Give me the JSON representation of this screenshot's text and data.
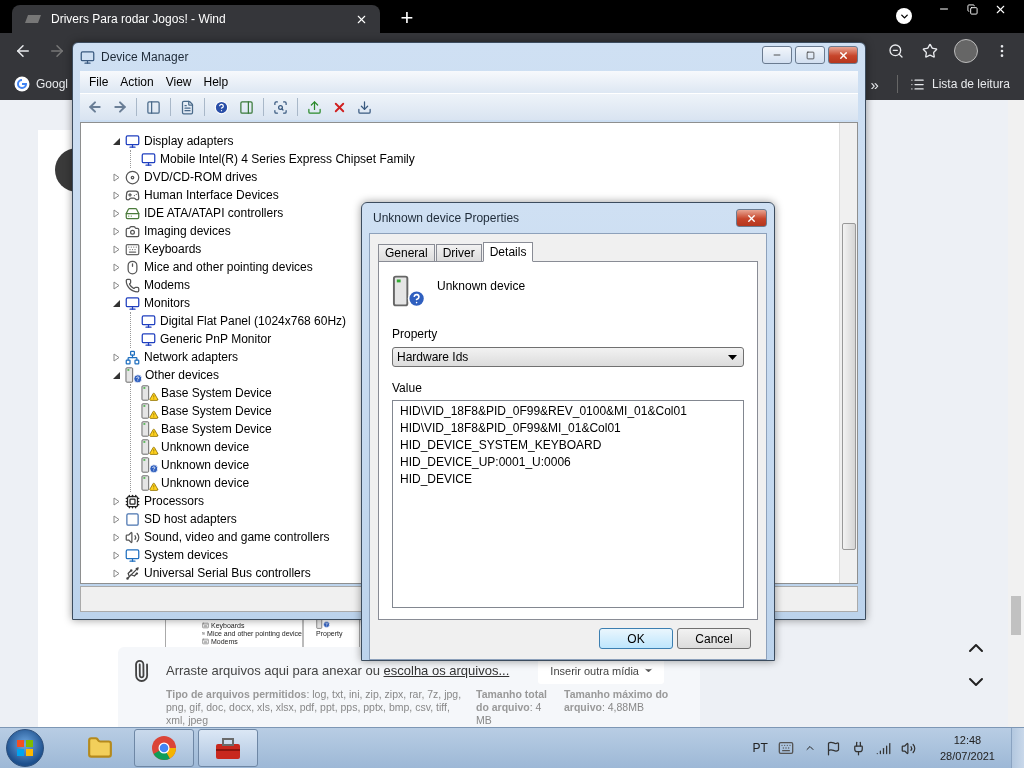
{
  "browser": {
    "tab_title": "Drivers Para rodar Jogos! - Wind",
    "new_tab": "+",
    "bookmarks": [
      {
        "label": "Googl"
      }
    ],
    "bookmarks_overflow": "»",
    "reading_list": "Lista de leitura"
  },
  "page": {
    "thumbnail": {
      "tree_items": [
        "Keyboards",
        "Mice and other pointing device",
        "Modems"
      ],
      "property_label": "Property"
    },
    "attachments": {
      "prompt": "Arraste arquivos aqui para anexar ou",
      "link": "escolha os arquivos...",
      "media_button": "Inserir outra mídia",
      "allowed_types": "**Tipo de arquivos permitidos**: log, txt, ini, zip, zipx, rar, 7z, jpg, png, gif, doc, docx, xls, xlsx, pdf, ppt, pps, pptx, bmp, csv, tiff, xml, jpeg",
      "total_size": "**Tamanho total do arquivo**: 4 MB",
      "max_size": "**Tamanho máximo do arquivo**: 4,88MB"
    }
  },
  "device_manager": {
    "title": "Device Manager",
    "menu": [
      "File",
      "Action",
      "View",
      "Help"
    ],
    "tree": [
      {
        "label": "Display adapters",
        "expanded": true,
        "children": [
          {
            "label": "Mobile Intel(R) 4 Series Express Chipset Family"
          }
        ]
      },
      {
        "label": "DVD/CD-ROM drives",
        "expanded": false
      },
      {
        "label": "Human Interface Devices",
        "expanded": false
      },
      {
        "label": "IDE ATA/ATAPI controllers",
        "expanded": false
      },
      {
        "label": "Imaging devices",
        "expanded": false
      },
      {
        "label": "Keyboards",
        "expanded": false
      },
      {
        "label": "Mice and other pointing devices",
        "expanded": false
      },
      {
        "label": "Modems",
        "expanded": false
      },
      {
        "label": "Monitors",
        "expanded": true,
        "children": [
          {
            "label": "Digital Flat Panel (1024x768 60Hz)"
          },
          {
            "label": "Generic PnP Monitor"
          }
        ]
      },
      {
        "label": "Network adapters",
        "expanded": false
      },
      {
        "label": "Other devices",
        "expanded": true,
        "children": [
          {
            "label": "Base System Device",
            "kind": "warning"
          },
          {
            "label": "Base System Device",
            "kind": "warning"
          },
          {
            "label": "Base System Device",
            "kind": "warning"
          },
          {
            "label": "Unknown device",
            "kind": "warning"
          },
          {
            "label": "Unknown device",
            "kind": "unknown"
          },
          {
            "label": "Unknown device",
            "kind": "warning"
          }
        ]
      },
      {
        "label": "Processors",
        "expanded": false
      },
      {
        "label": "SD host adapters",
        "expanded": false
      },
      {
        "label": "Sound, video and game controllers",
        "expanded": false
      },
      {
        "label": "System devices",
        "expanded": false
      },
      {
        "label": "Universal Serial Bus controllers",
        "expanded": false
      }
    ]
  },
  "dialog": {
    "title": "Unknown device Properties",
    "tabs": [
      {
        "label": "General",
        "selected": false
      },
      {
        "label": "Driver",
        "selected": false
      },
      {
        "label": "Details",
        "selected": true
      }
    ],
    "device_name": "Unknown device",
    "property_label": "Property",
    "property_value": "Hardware Ids",
    "value_label": "Value",
    "values": [
      "HID\\VID_18F8&PID_0F99&REV_0100&MI_01&Col01",
      "HID\\VID_18F8&PID_0F99&MI_01&Col01",
      "HID_DEVICE_SYSTEM_KEYBOARD",
      "HID_DEVICE_UP:0001_U:0006",
      "HID_DEVICE"
    ],
    "buttons": [
      "OK",
      "Cancel"
    ]
  },
  "taskbar": {
    "items": [
      {
        "running": false,
        "selected": false
      },
      {
        "running": true,
        "selected": false
      },
      {
        "running": true,
        "selected": true
      }
    ],
    "language": "PT",
    "time": "12:48",
    "date": "28/07/2021"
  }
}
